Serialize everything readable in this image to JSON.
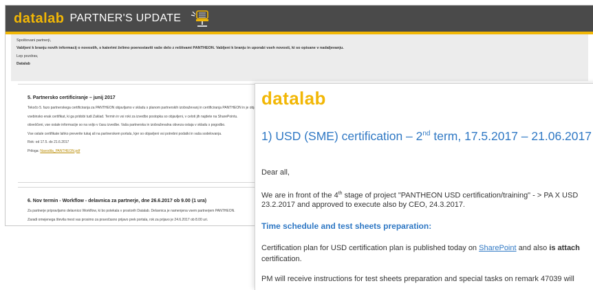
{
  "newsletter": {
    "logo": "datalab",
    "title": "PARTNER'S UPDATE",
    "intro": {
      "greeting": "Spoštovani partnerji,",
      "line": "Vabljeni k branju novih informacij o novostih, s katerimi želimo poenostaviti vaše delo z rešitvami PANTHEON. Vabljeni k branju in uporabi vseh novosti, ki so opisane v nadaljevanju.",
      "closing": "Lep pozdrav,",
      "signature": "Datalab"
    },
    "sections": [
      {
        "title": "5. Partnersko certificiranje – junij 2017",
        "lines": [
          "Tekočo 5. fazo partnerskega certificiranja za PANTHEON objavljamo v skladu s planom partnerskih izobraževanj in certificiranja PANTHEON in je objavljena v portalu.",
          "vsebinsko enak certifikat, ki ga pridobi tudi Zaklad. Termin in vsi roki za izvedbo postopka so objavljeni, v celoti jih najdete na SharePointu.",
          "obveščeni, vse ostale informacije so na voljo v času izvedbe. Vaša partnerska in izobraževalna obveza ostaja v skladu s pogodbo.",
          "Vse ostale certifikate lahko preverite tukaj ali na partnerskem portalu, kjer so objavljeni vsi potrebni podatki in vaša sodelovanja."
        ],
        "link_line_prefix": "Rok: od 17.5. do 21.6.2017",
        "attachment_label": "Priloga:",
        "attachment_link": "Navodila_PANTHEON.pdf"
      },
      {
        "title": "6. Nov termin - Workflow - delavnica za partnerje, dne 26.6.2017 ob 9.00 (1 ura)",
        "lines": [
          "Za partnerje pripravljamo delavnico Workflow, ki bo potekala v prostorih Datalab. Delavnica je namenjena vsem partnerjem PANTHEON.",
          "Zaradi omejenega števila mest vas prosimo za pravočasno prijavo prek portala, rok za prijavo je 24.6.2017 ob 8.00 uri."
        ]
      }
    ]
  },
  "email": {
    "logo": "datalab",
    "heading_part1": "1) USD (SME) certification – 2",
    "heading_sup": "nd",
    "heading_part2": " term, 17.5.2017 – 21.06.2017",
    "greeting": "Dear all,",
    "para1_a": "We are in front of the 4",
    "para1_sup": "th",
    "para1_b": " stage of project \"PANTHEON USD certification/training\" - > PA X USD",
    "para1_line2": "23.2.2017 and approved to execute also by CEO, 24.3.2017.",
    "subheading": "Time schedule and test sheets preparation:",
    "para2_a": "Certification plan for USD certification plan is published today on ",
    "para2_link": "SharePoint",
    "para2_b": " and also ",
    "para2_bold": "is attach",
    "para2_line2": "certification.",
    "para3": "PM will receive instructions for test sheets preparation and special tasks on remark 47039 will"
  },
  "colors": {
    "brand_yellow": "#f2b705",
    "heading_blue": "#2f78c4",
    "banner_gray": "#4a4a4a"
  },
  "icons": [
    "office-chair-icon"
  ]
}
